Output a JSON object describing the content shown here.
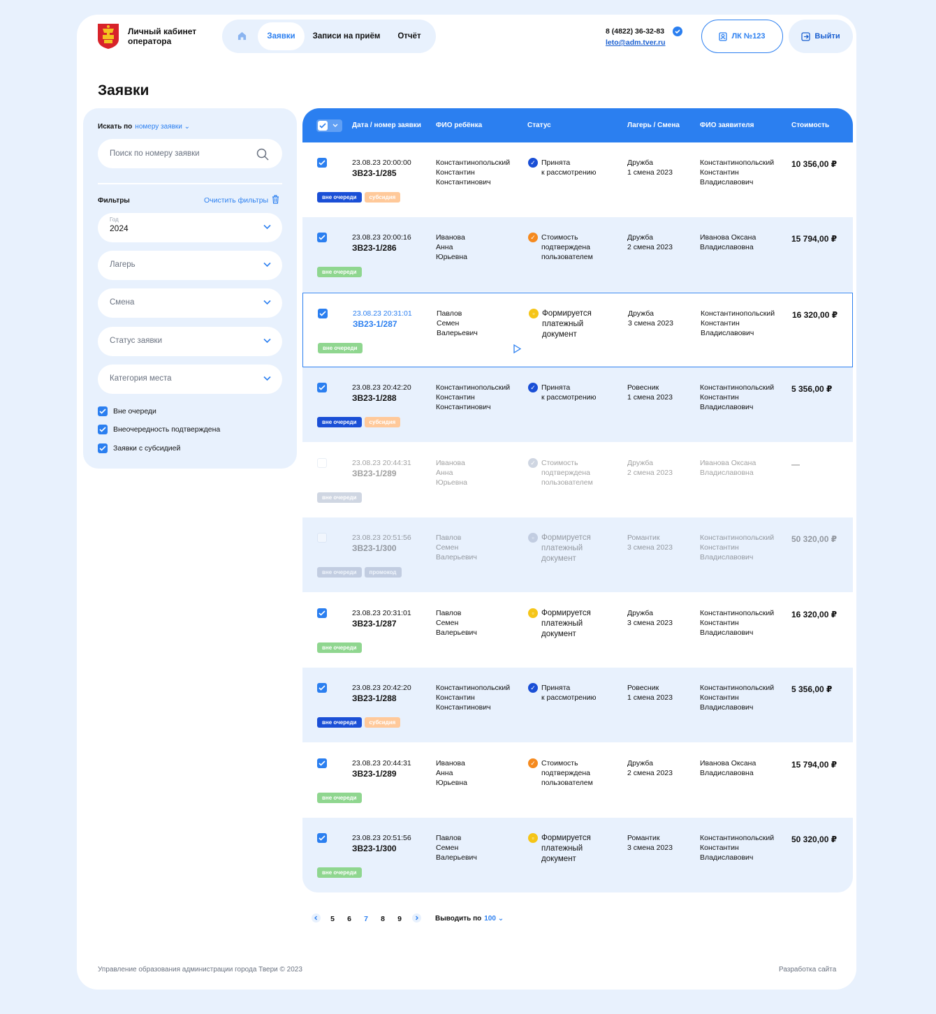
{
  "header": {
    "title_line1": "Личный кабинет",
    "title_line2": "оператора",
    "nav": [
      {
        "label": "",
        "icon": "home-icon"
      },
      {
        "label": "Заявки",
        "active": true
      },
      {
        "label": "Записи на приём"
      },
      {
        "label": "Отчёт"
      }
    ],
    "phone": "8 (4822) 36-32-83",
    "email": "leto@adm.tver.ru",
    "lk_label": "ЛК №123",
    "logout_label": "Выйти"
  },
  "page_title": "Заявки",
  "sidebar": {
    "search_by_label": "Искать по",
    "search_by_value": "номеру заявки",
    "search_placeholder": "Поиск по номеру заявки",
    "filters_label": "Фильтры",
    "clear_filters": "Очистить фильтры",
    "year_label": "Год",
    "year_value": "2024",
    "selects": [
      "Лагерь",
      "Смена",
      "Статус заявки",
      "Категория места"
    ],
    "checkboxes": [
      {
        "label": "Вне очереди",
        "checked": true
      },
      {
        "label": "Внеочередность подтверждена",
        "checked": true
      },
      {
        "label": "Заявки с субсидией",
        "checked": true
      }
    ]
  },
  "table": {
    "columns": [
      "Дата / номер заявки",
      "ФИО ребёнка",
      "Статус",
      "Лагерь / Смена",
      "ФИО заявителя",
      "Стоимость"
    ],
    "rows": [
      {
        "date": "23.08.23 20:00:00",
        "num": "ЗВ23-1/285",
        "fio": [
          "Константинопольский",
          "Константин",
          "Константинович"
        ],
        "status": [
          "Принята",
          "к рассмотрению"
        ],
        "status_type": "accepted",
        "camp": [
          "Дружба",
          "1 смена 2023"
        ],
        "applicant": [
          "Константинопольский",
          "Константин",
          "Владиславович"
        ],
        "cost": "10 356,00 ₽",
        "tags": [
          "вне очереди",
          "субсидия"
        ],
        "checked": true
      },
      {
        "date": "23.08.23 20:00:16",
        "num": "ЗВ23-1/286",
        "fio": [
          "Иванова",
          "Анна",
          "Юрьевна"
        ],
        "status": [
          "Стоимость",
          "подтверждена",
          "пользователем"
        ],
        "status_type": "cost",
        "camp": [
          "Дружба",
          "2 смена 2023"
        ],
        "applicant": [
          "Иванова Оксана",
          "Владиславовна"
        ],
        "cost": "15 794,00 ₽",
        "tags": [
          "вне очереди"
        ],
        "checked": true
      },
      {
        "date": "23.08.23 20:31:01",
        "num": "ЗВ23-1/287",
        "fio": [
          "Павлов",
          "Семен",
          "Валерьевич"
        ],
        "status": [
          "Формируется",
          "платежный",
          "документ"
        ],
        "status_type": "doc",
        "camp": [
          "Дружба",
          "3 смена 2023"
        ],
        "applicant": [
          "Константинопольский",
          "Константин",
          "Владиславович"
        ],
        "cost": "16 320,00 ₽",
        "tags": [
          "вне очереди"
        ],
        "checked": true
      },
      {
        "date": "23.08.23 20:42:20",
        "num": "ЗВ23-1/288",
        "fio": [
          "Константинопольский",
          "Константин",
          "Константинович"
        ],
        "status": [
          "Принята",
          "к рассмотрению"
        ],
        "status_type": "accepted",
        "camp": [
          "Ровесник",
          "1 смена 2023"
        ],
        "applicant": [
          "Константинопольский",
          "Константин",
          "Владиславович"
        ],
        "cost": "5 356,00 ₽",
        "tags": [
          "вне очереди",
          "субсидия"
        ],
        "checked": true
      },
      {
        "date": "23.08.23 20:44:31",
        "num": "ЗВ23-1/289",
        "fio": [
          "Иванова",
          "Анна",
          "Юрьевна"
        ],
        "status": [
          "Стоимость",
          "подтверждена",
          "пользователем"
        ],
        "status_type": "cost",
        "camp": [
          "Дружба",
          "2 смена 2023"
        ],
        "applicant": [
          "Иванова Оксана",
          "Владиславовна"
        ],
        "cost": "—",
        "tags": [
          "вне очереди"
        ],
        "checked": false
      },
      {
        "date": "23.08.23 20:51:56",
        "num": "ЗВ23-1/300",
        "fio": [
          "Павлов",
          "Семен",
          "Валерьевич"
        ],
        "status": [
          "Формируется",
          "платежный",
          "документ"
        ],
        "status_type": "doc",
        "camp": [
          "Романтик",
          "3 смена 2023"
        ],
        "applicant": [
          "Константинопольский",
          "Константин",
          "Владиславович"
        ],
        "cost": "50 320,00 ₽",
        "tags": [
          "вне очереди",
          "промокод"
        ],
        "checked": false
      },
      {
        "date": "23.08.23 20:31:01",
        "num": "ЗВ23-1/287",
        "fio": [
          "Павлов",
          "Семен",
          "Валерьевич"
        ],
        "status": [
          "Формируется",
          "платежный",
          "документ"
        ],
        "status_type": "doc",
        "camp": [
          "Дружба",
          "3 смена 2023"
        ],
        "applicant": [
          "Константинопольский",
          "Константин",
          "Владиславович"
        ],
        "cost": "16 320,00 ₽",
        "tags": [
          "вне очереди"
        ],
        "checked": true
      },
      {
        "date": "23.08.23 20:42:20",
        "num": "ЗВ23-1/288",
        "fio": [
          "Константинопольский",
          "Константин",
          "Константинович"
        ],
        "status": [
          "Принята",
          "к рассмотрению"
        ],
        "status_type": "accepted",
        "camp": [
          "Ровесник",
          "1 смена 2023"
        ],
        "applicant": [
          "Константинопольский",
          "Константин",
          "Владиславович"
        ],
        "cost": "5 356,00 ₽",
        "tags": [
          "вне очереди",
          "субсидия"
        ],
        "checked": true
      },
      {
        "date": "23.08.23 20:44:31",
        "num": "ЗВ23-1/289",
        "fio": [
          "Иванова",
          "Анна",
          "Юрьевна"
        ],
        "status": [
          "Стоимость",
          "подтверждена",
          "пользователем"
        ],
        "status_type": "cost",
        "camp": [
          "Дружба",
          "2 смена 2023"
        ],
        "applicant": [
          "Иванова Оксана",
          "Владиславовна"
        ],
        "cost": "15 794,00 ₽",
        "tags": [
          "вне очереди"
        ],
        "checked": true
      },
      {
        "date": "23.08.23 20:51:56",
        "num": "ЗВ23-1/300",
        "fio": [
          "Павлов",
          "Семен",
          "Валерьевич"
        ],
        "status": [
          "Формируется",
          "платежный",
          "документ"
        ],
        "status_type": "doc",
        "camp": [
          "Романтик",
          "3 смена 2023"
        ],
        "applicant": [
          "Константинопольский",
          "Константин",
          "Владиславович"
        ],
        "cost": "50 320,00 ₽",
        "tags": [
          "вне очереди"
        ],
        "checked": true
      }
    ]
  },
  "pagination": {
    "pages": [
      "5",
      "6",
      "7",
      "8",
      "9"
    ],
    "current": "7",
    "per_page_label": "Выводить по",
    "per_page_value": "100"
  },
  "footer": {
    "left": "Управление образования администрации города Твери © 2023",
    "right": "Разработка сайта"
  },
  "colors": {
    "accent": "#2b7ff0",
    "tag_blue": "#1a4fd6",
    "tag_green": "#8fd68f",
    "tag_orange": "#ffc99a",
    "tag_gray": "#8a9ab8",
    "status_orange": "#f58a1f",
    "status_yellow": "#f5c518"
  }
}
